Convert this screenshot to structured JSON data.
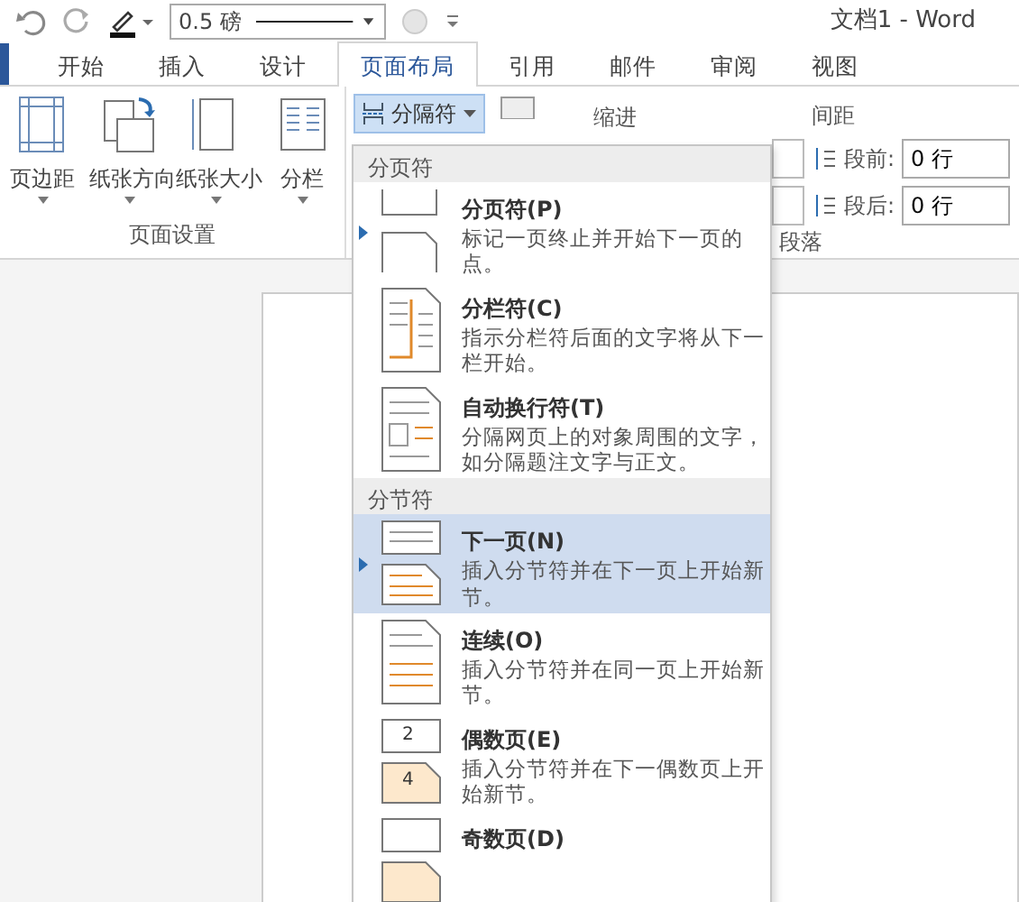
{
  "window": {
    "title": "文档1 - Word"
  },
  "quick_access": {
    "line_weight": "0.5 磅"
  },
  "tabs": [
    {
      "label": "开始",
      "selected": false
    },
    {
      "label": "插入",
      "selected": false
    },
    {
      "label": "设计",
      "selected": false
    },
    {
      "label": "页面布局",
      "selected": true
    },
    {
      "label": "引用",
      "selected": false
    },
    {
      "label": "邮件",
      "selected": false
    },
    {
      "label": "审阅",
      "selected": false
    },
    {
      "label": "视图",
      "selected": false
    }
  ],
  "ribbon": {
    "page_setup": {
      "buttons": [
        {
          "label": "页边距",
          "kind": "margins"
        },
        {
          "label": "纸张方向",
          "kind": "orientation"
        },
        {
          "label": "纸张大小",
          "kind": "size"
        },
        {
          "label": "分栏",
          "kind": "columns"
        }
      ],
      "label": "页面设置"
    },
    "breaks_button": {
      "label": "分隔符",
      "pressed": true
    },
    "indent_label": "缩进",
    "spacing_label": "间距",
    "spacing": [
      {
        "label": "段前:",
        "value": "0 行"
      },
      {
        "label": "段后:",
        "value": "0 行"
      }
    ],
    "paragraph_label": "段落"
  },
  "breaks_menu": {
    "sections": [
      {
        "header": "分页符",
        "items": [
          {
            "title": "分页符(P)",
            "description": "标记一页终止并开始下一页的点。",
            "kind": "page",
            "selected": false,
            "marked": true
          },
          {
            "title": "分栏符(C)",
            "description": "指示分栏符后面的文字将从下一栏开始。",
            "kind": "column",
            "selected": false,
            "marked": false
          },
          {
            "title": "自动换行符(T)",
            "description": "分隔网页上的对象周围的文字，如分隔题注文字与正文。",
            "kind": "wrap",
            "selected": false,
            "marked": false
          }
        ]
      },
      {
        "header": "分节符",
        "items": [
          {
            "title": "下一页(N)",
            "description": "插入分节符并在下一页上开始新节。",
            "kind": "next",
            "selected": true,
            "marked": true
          },
          {
            "title": "连续(O)",
            "description": "插入分节符并在同一页上开始新节。",
            "kind": "continuous",
            "selected": false,
            "marked": false
          },
          {
            "title": "偶数页(E)",
            "description": "插入分节符并在下一偶数页上开始新节。",
            "kind": "even",
            "icon_numbers": [
              "2",
              "4"
            ],
            "selected": false,
            "marked": false
          },
          {
            "title": "奇数页(D)",
            "kind": "odd",
            "selected": false,
            "marked": false
          }
        ]
      }
    ]
  }
}
